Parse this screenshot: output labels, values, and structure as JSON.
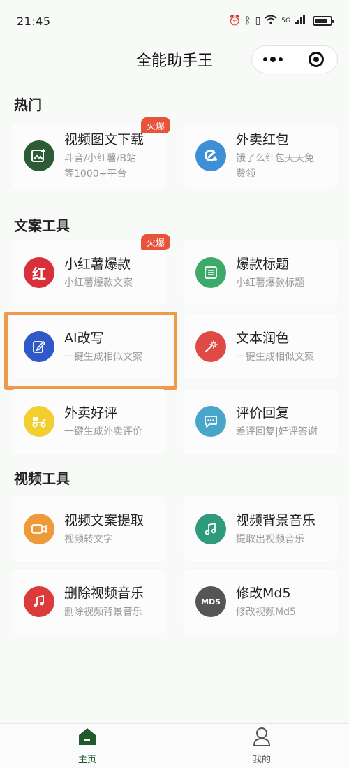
{
  "status_bar": {
    "time": "21:45",
    "network": "5G"
  },
  "header": {
    "title": "全能助手王"
  },
  "sections": [
    {
      "title": "热门",
      "items": [
        {
          "name": "视频图文下载",
          "desc_line1": "斗音/小红薯/B站",
          "desc_line2": "等1000+平台",
          "badge": "火爆",
          "icon": "image-plus-icon",
          "color": "#2d5b33"
        },
        {
          "name": "外卖红包",
          "desc_line1": "饿了么红包天天免",
          "desc_line2": "费领",
          "icon": "e-logo-icon",
          "color": "#3e8fd6"
        }
      ]
    },
    {
      "title": "文案工具",
      "items": [
        {
          "name": "小红薯爆款",
          "desc_line1": "小红薯爆款文案",
          "badge": "火爆",
          "icon": "hong-char-icon",
          "color": "#d8303a"
        },
        {
          "name": "爆款标题",
          "desc_line1": "小红薯爆款标题",
          "icon": "list-doc-icon",
          "color": "#3daa6a"
        },
        {
          "name": "AI改写",
          "desc_line1": "一键生成相似文案",
          "icon": "edit-icon",
          "color": "#2f58c9"
        },
        {
          "name": "文本润色",
          "desc_line1": "一键生成相似文案",
          "icon": "magic-wand-icon",
          "color": "#e04a45"
        },
        {
          "name": "外卖好评",
          "desc_line1": "一键生成外卖评价",
          "icon": "scooter-icon",
          "color": "#f2cf2e"
        },
        {
          "name": "评价回复",
          "desc_line1": "差评回复|好评答谢",
          "icon": "chat-bubble-icon",
          "color": "#4aa6c9"
        }
      ]
    },
    {
      "title": "视频工具",
      "items": [
        {
          "name": "视频文案提取",
          "desc_line1": "视频转文字",
          "icon": "video-camera-icon",
          "color": "#ef9a3a"
        },
        {
          "name": "视频背景音乐",
          "desc_line1": "提取出视频音乐",
          "icon": "music-note-icon",
          "color": "#2f9a7c"
        },
        {
          "name": "删除视频音乐",
          "desc_line1": "删除视频背景音乐",
          "icon": "music-note-icon",
          "color": "#db3b3a"
        },
        {
          "name": "修改Md5",
          "desc_line1": "修改视频Md5",
          "icon": "md5-icon",
          "icon_text": "MD5",
          "color": "#555555"
        }
      ]
    }
  ],
  "tabs": [
    {
      "label": "主页",
      "icon": "home-icon",
      "active": true
    },
    {
      "label": "我的",
      "icon": "user-icon",
      "active": false
    }
  ],
  "colors": {
    "accent": "#1f5a2d",
    "badge": "#e8533c",
    "highlight": "#ee9a4d"
  }
}
